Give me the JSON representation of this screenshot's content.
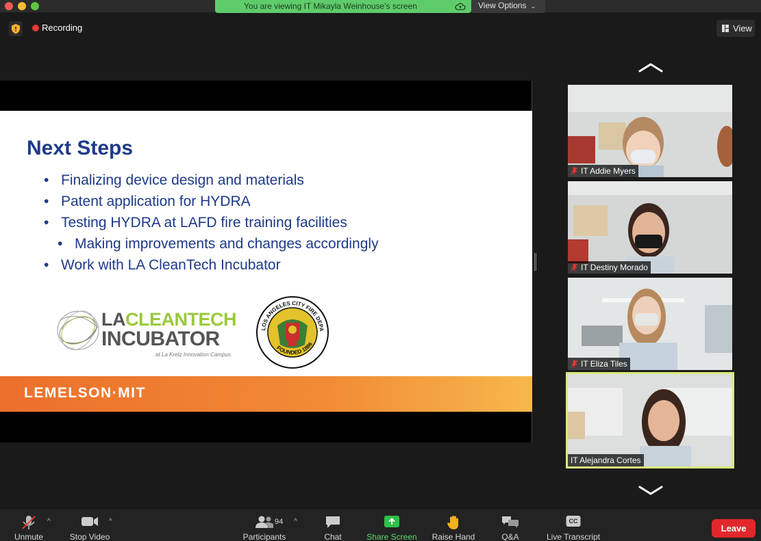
{
  "window": {
    "viewing_banner": "You are viewing IT Mikayla Weinhouse's screen",
    "view_options": "View Options"
  },
  "topbar": {
    "recording_label": "Recording",
    "view_label": "View"
  },
  "slide": {
    "title": "Next Steps",
    "bullets": [
      "Finalizing device design and materials",
      "Patent application for HYDRA",
      "Testing HYDRA at LAFD fire training facilities",
      "Making improvements and changes accordingly",
      "Work with LA CleanTech Incubator"
    ],
    "logo_la": "LA",
    "logo_cleantech": "CLEANTECH",
    "logo_incubator": "INCUBATOR",
    "logo_campus": "at La Kretz Innovation Campus",
    "seal_text": "LOS ANGELES CITY FIRE DEPARTMENT",
    "seal_founded": "FOUNDED 1886",
    "footer_logo": "LEMELSON·MIT"
  },
  "participants_gallery": [
    {
      "name": "IT Addie Myers",
      "muted": true
    },
    {
      "name": "IT Destiny Morado",
      "muted": true
    },
    {
      "name": "IT Eliza Tiles",
      "muted": true
    },
    {
      "name": "IT Alejandra Cortes",
      "muted": false,
      "active_speaker": true
    }
  ],
  "toolbar": {
    "unmute": "Unmute",
    "stop_video": "Stop Video",
    "participants": "Participants",
    "participants_count": "94",
    "chat": "Chat",
    "share_screen": "Share Screen",
    "raise_hand": "Raise Hand",
    "qa": "Q&A",
    "live_transcript": "Live Transcript",
    "cc_badge": "CC",
    "leave": "Leave"
  },
  "colors": {
    "banner_green": "#5fcc6b",
    "slide_navy": "#1d3a8a",
    "leave_red": "#e0282c",
    "active_border": "#d9e87a",
    "share_green": "#2fbf4a"
  },
  "icons": [
    "shield-icon",
    "record-icon",
    "view-grid-icon",
    "chevron-up-icon",
    "chevron-down-icon",
    "mic-muted-icon",
    "video-icon",
    "participants-icon",
    "chat-icon",
    "share-screen-icon",
    "raise-hand-icon",
    "qa-icon",
    "cc-icon",
    "cloud-icon"
  ]
}
